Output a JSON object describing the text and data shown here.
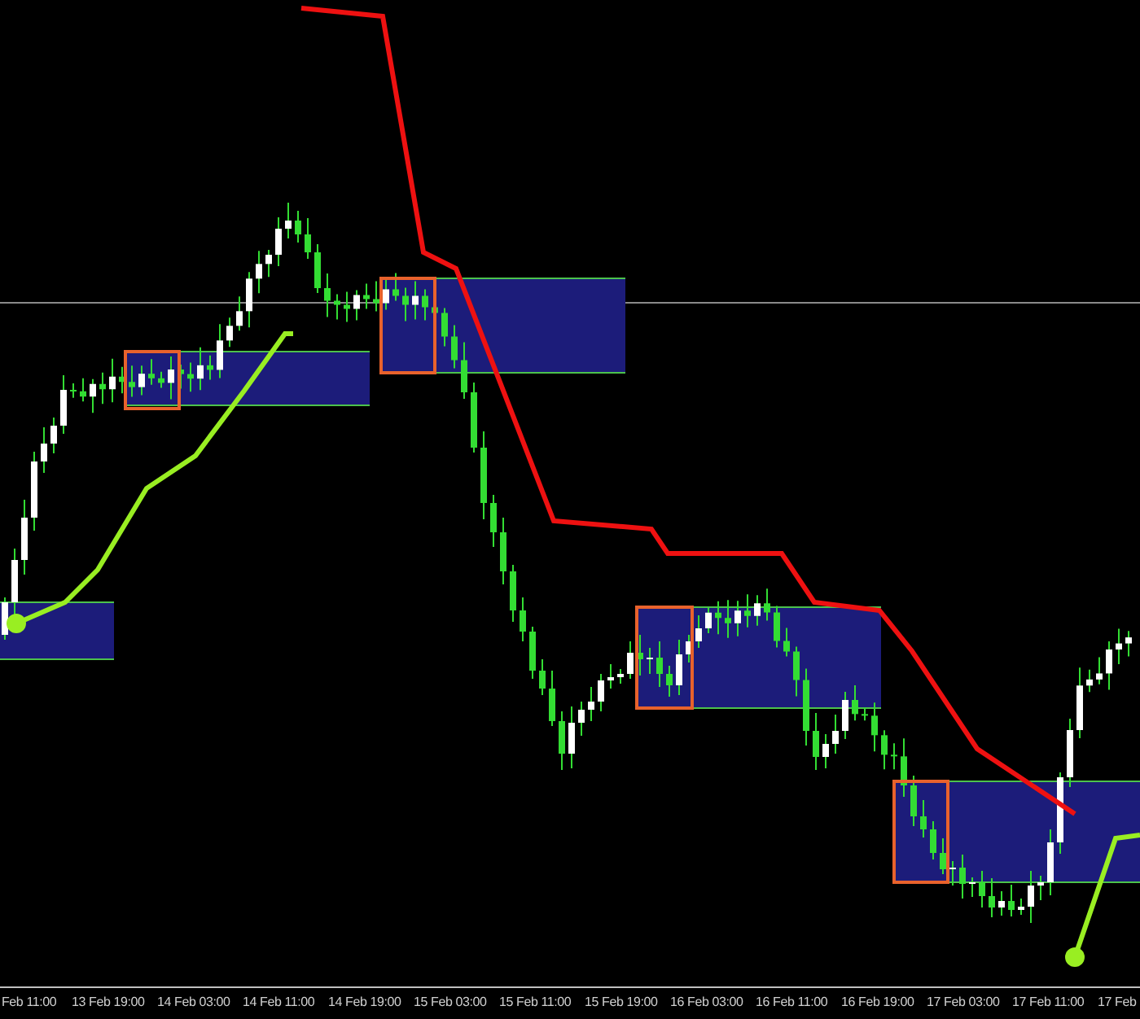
{
  "time_axis": {
    "labels": [
      "Feb 11:00",
      "13 Feb 19:00",
      "14 Feb 03:00",
      "14 Feb 11:00",
      "14 Feb 19:00",
      "15 Feb 03:00",
      "15 Feb 11:00",
      "15 Feb 19:00",
      "16 Feb 03:00",
      "16 Feb 11:00",
      "16 Feb 19:00",
      "17 Feb 03:00",
      "17 Feb 11:00",
      "17 Feb"
    ]
  }
}
